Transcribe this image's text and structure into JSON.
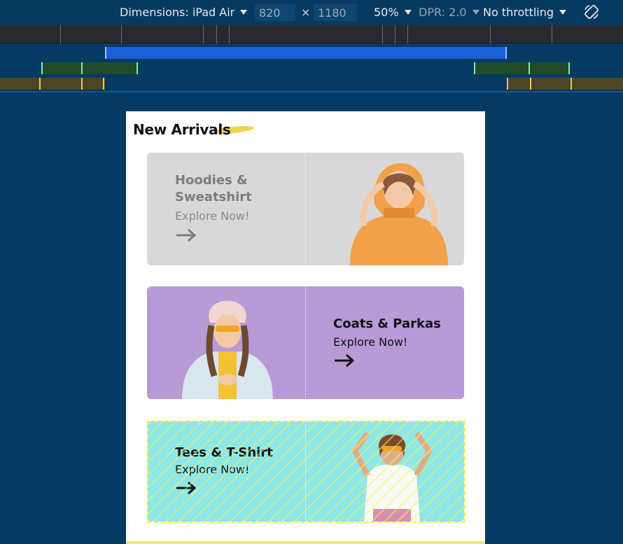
{
  "toolbar": {
    "dimensions_label": "Dimensions: iPad Air",
    "width_value": "820",
    "times": "×",
    "height_value": "1180",
    "zoom": "50%",
    "dpr": "DPR: 2.0",
    "throttling": "No throttling",
    "rotate_icon": "rotate-icon"
  },
  "page": {
    "section_title": "New Arrivals",
    "cards": [
      {
        "title_line1": "Hoodies &",
        "title_line2": "Sweatshirt",
        "cta": "Explore Now!",
        "arrow_icon": "arrow-right-icon"
      },
      {
        "title_line1": "Coats & Parkas",
        "title_line2": "",
        "cta": "Explore Now!",
        "arrow_icon": "arrow-right-icon"
      },
      {
        "title_line1": "Tees & T-Shirt",
        "title_line2": "",
        "cta": "Explore Now!",
        "arrow_icon": "arrow-right-icon"
      }
    ]
  },
  "colors": {
    "toolbar_bg": "#073a61",
    "card1_bg": "#d8d8d8",
    "card2_bg": "#b79ad6",
    "card3_bg": "#8ee7e8",
    "media_query_blue": "#1a5fd6",
    "highlight_yellow": "#f4f25a"
  }
}
